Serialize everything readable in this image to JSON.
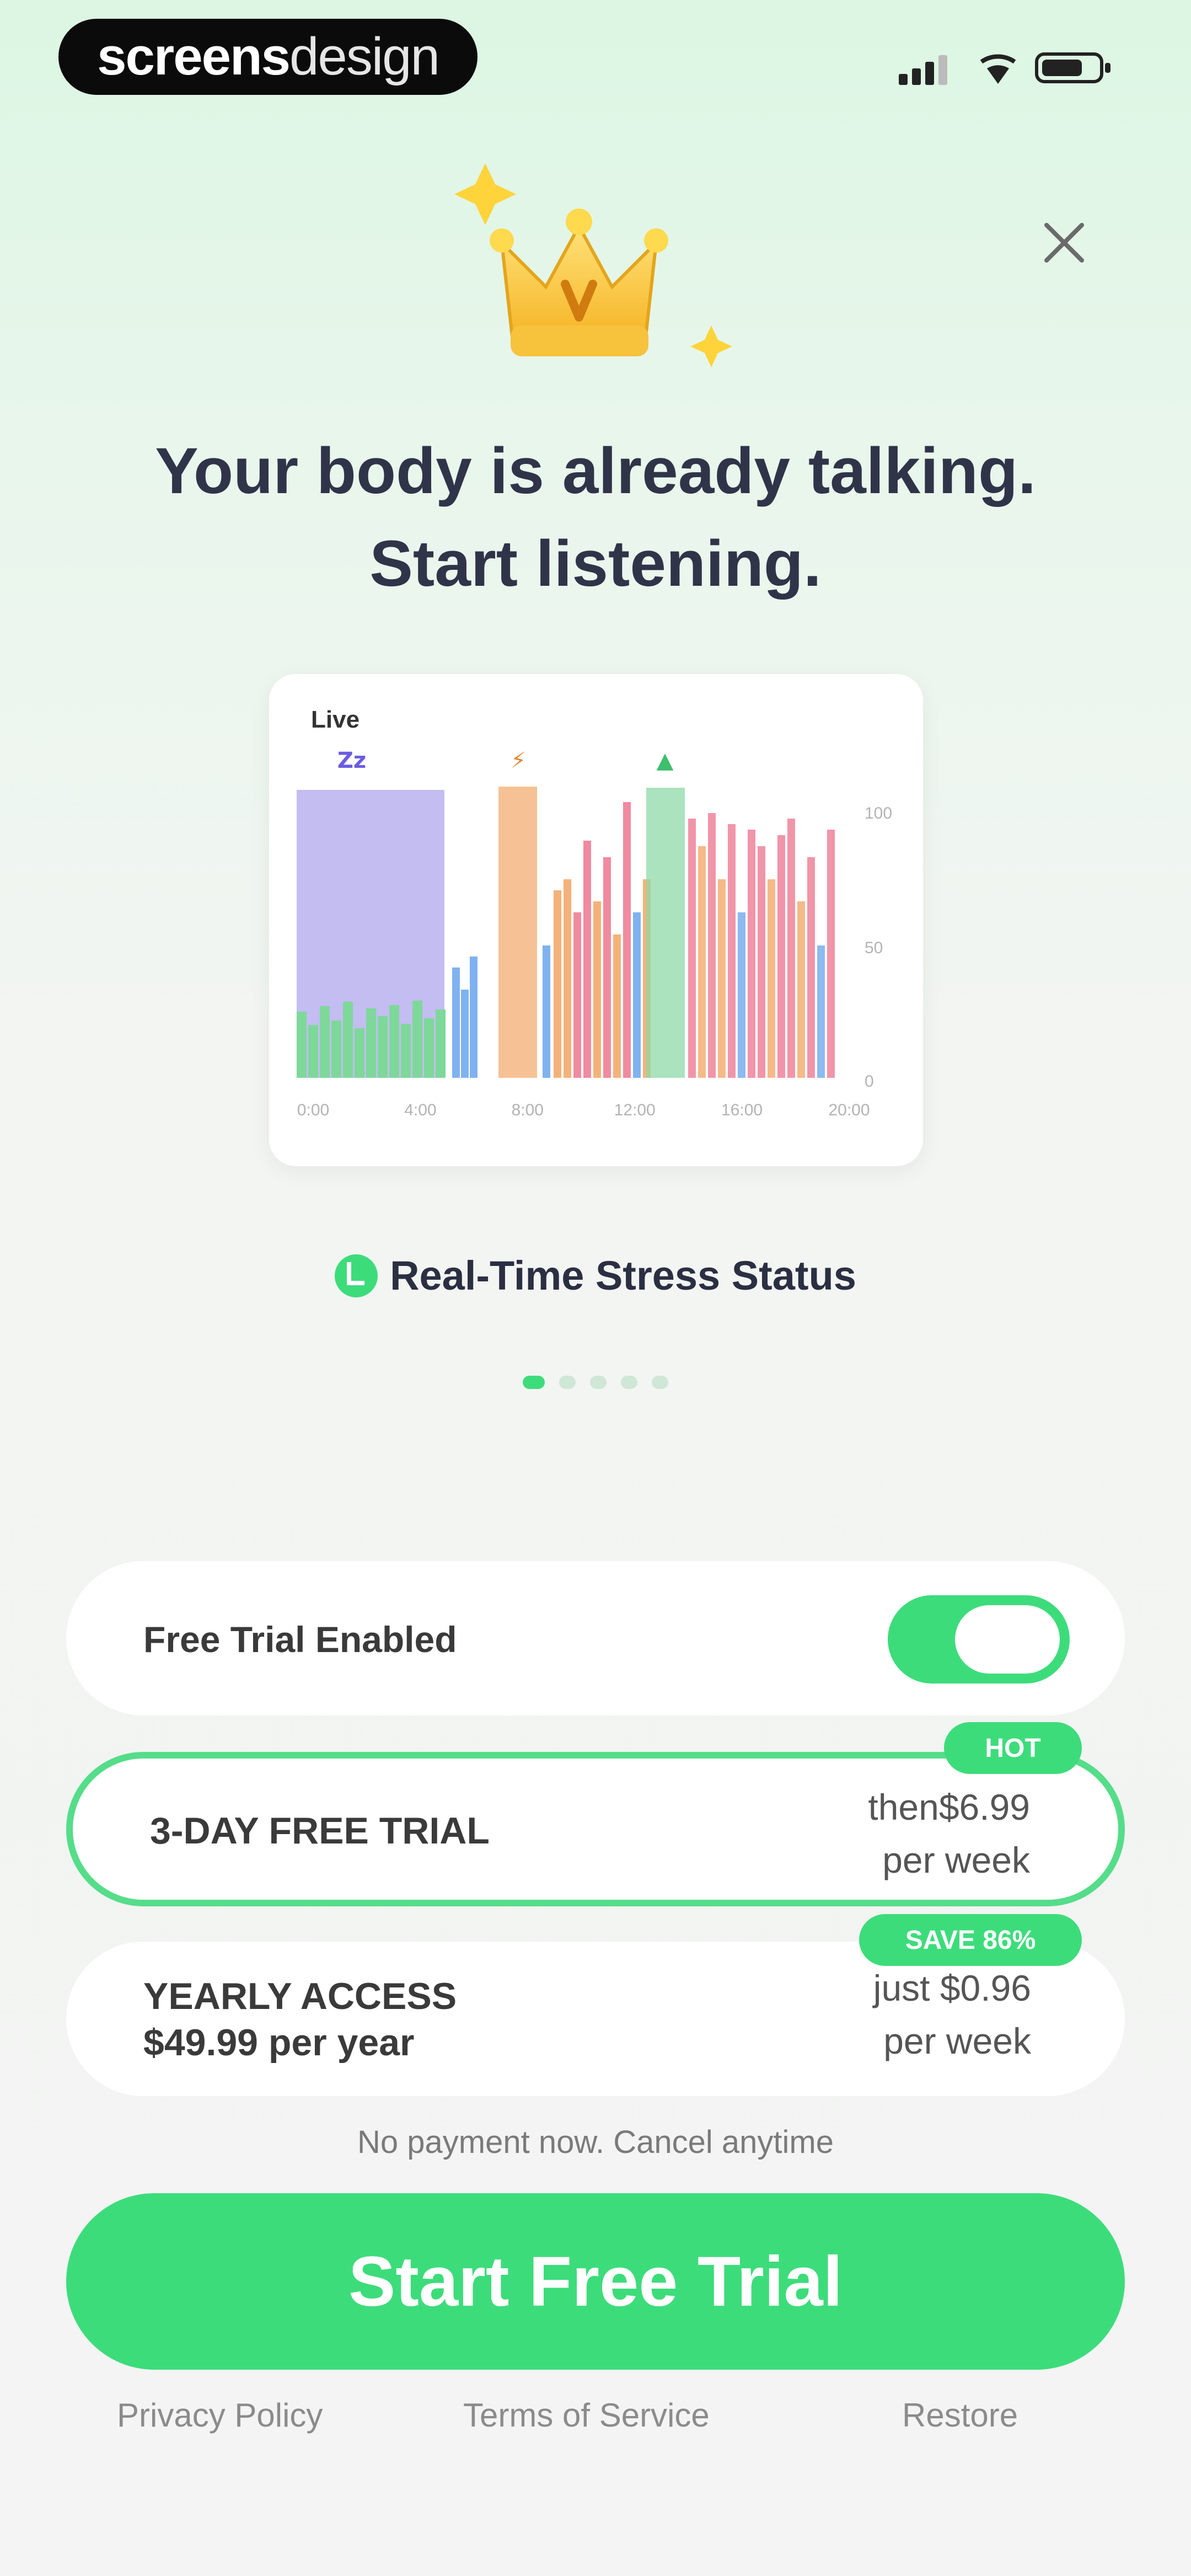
{
  "status": {
    "brand_bold": "screens",
    "brand_light": "design"
  },
  "headline": {
    "line1": "Your body is already talking.",
    "line2": "Start listening."
  },
  "chart_data": {
    "type": "bar",
    "title": "Live",
    "x_ticks": [
      "0:00",
      "4:00",
      "8:00",
      "12:00",
      "16:00",
      "20:00"
    ],
    "y_ticks": [
      "100",
      "50",
      "0"
    ],
    "ylim": [
      0,
      100
    ],
    "markers": [
      "Zz",
      "⚡",
      "▲"
    ],
    "colors": {
      "sleep": "#b9b1f0",
      "rest": "#7ed89a",
      "calm": "#7fb2f0",
      "active": "#f4b27a",
      "stress": "#f08aa0",
      "recovery": "#8fd9a8"
    }
  },
  "feature": {
    "label": "Real-Time Stress Status"
  },
  "pagination": {
    "count": 5,
    "active": 0
  },
  "trial_toggle": {
    "label": "Free Trial Enabled",
    "enabled": true
  },
  "plans": [
    {
      "title": "3-DAY FREE TRIAL",
      "subtitle": "",
      "price_line1": "then$6.99",
      "price_line2": "per week",
      "badge": "HOT",
      "selected": true
    },
    {
      "title": "YEARLY ACCESS",
      "subtitle": "$49.99 per year",
      "price_line1": "just $0.96",
      "price_line2": "per week",
      "badge": "SAVE 86%",
      "selected": false
    }
  ],
  "note": "No payment now. Cancel anytime",
  "cta": "Start Free Trial",
  "footer": {
    "privacy": "Privacy Policy",
    "terms": "Terms of Service",
    "restore": "Restore"
  },
  "colors": {
    "accent": "#3ddc7b",
    "text": "#2f3344"
  }
}
